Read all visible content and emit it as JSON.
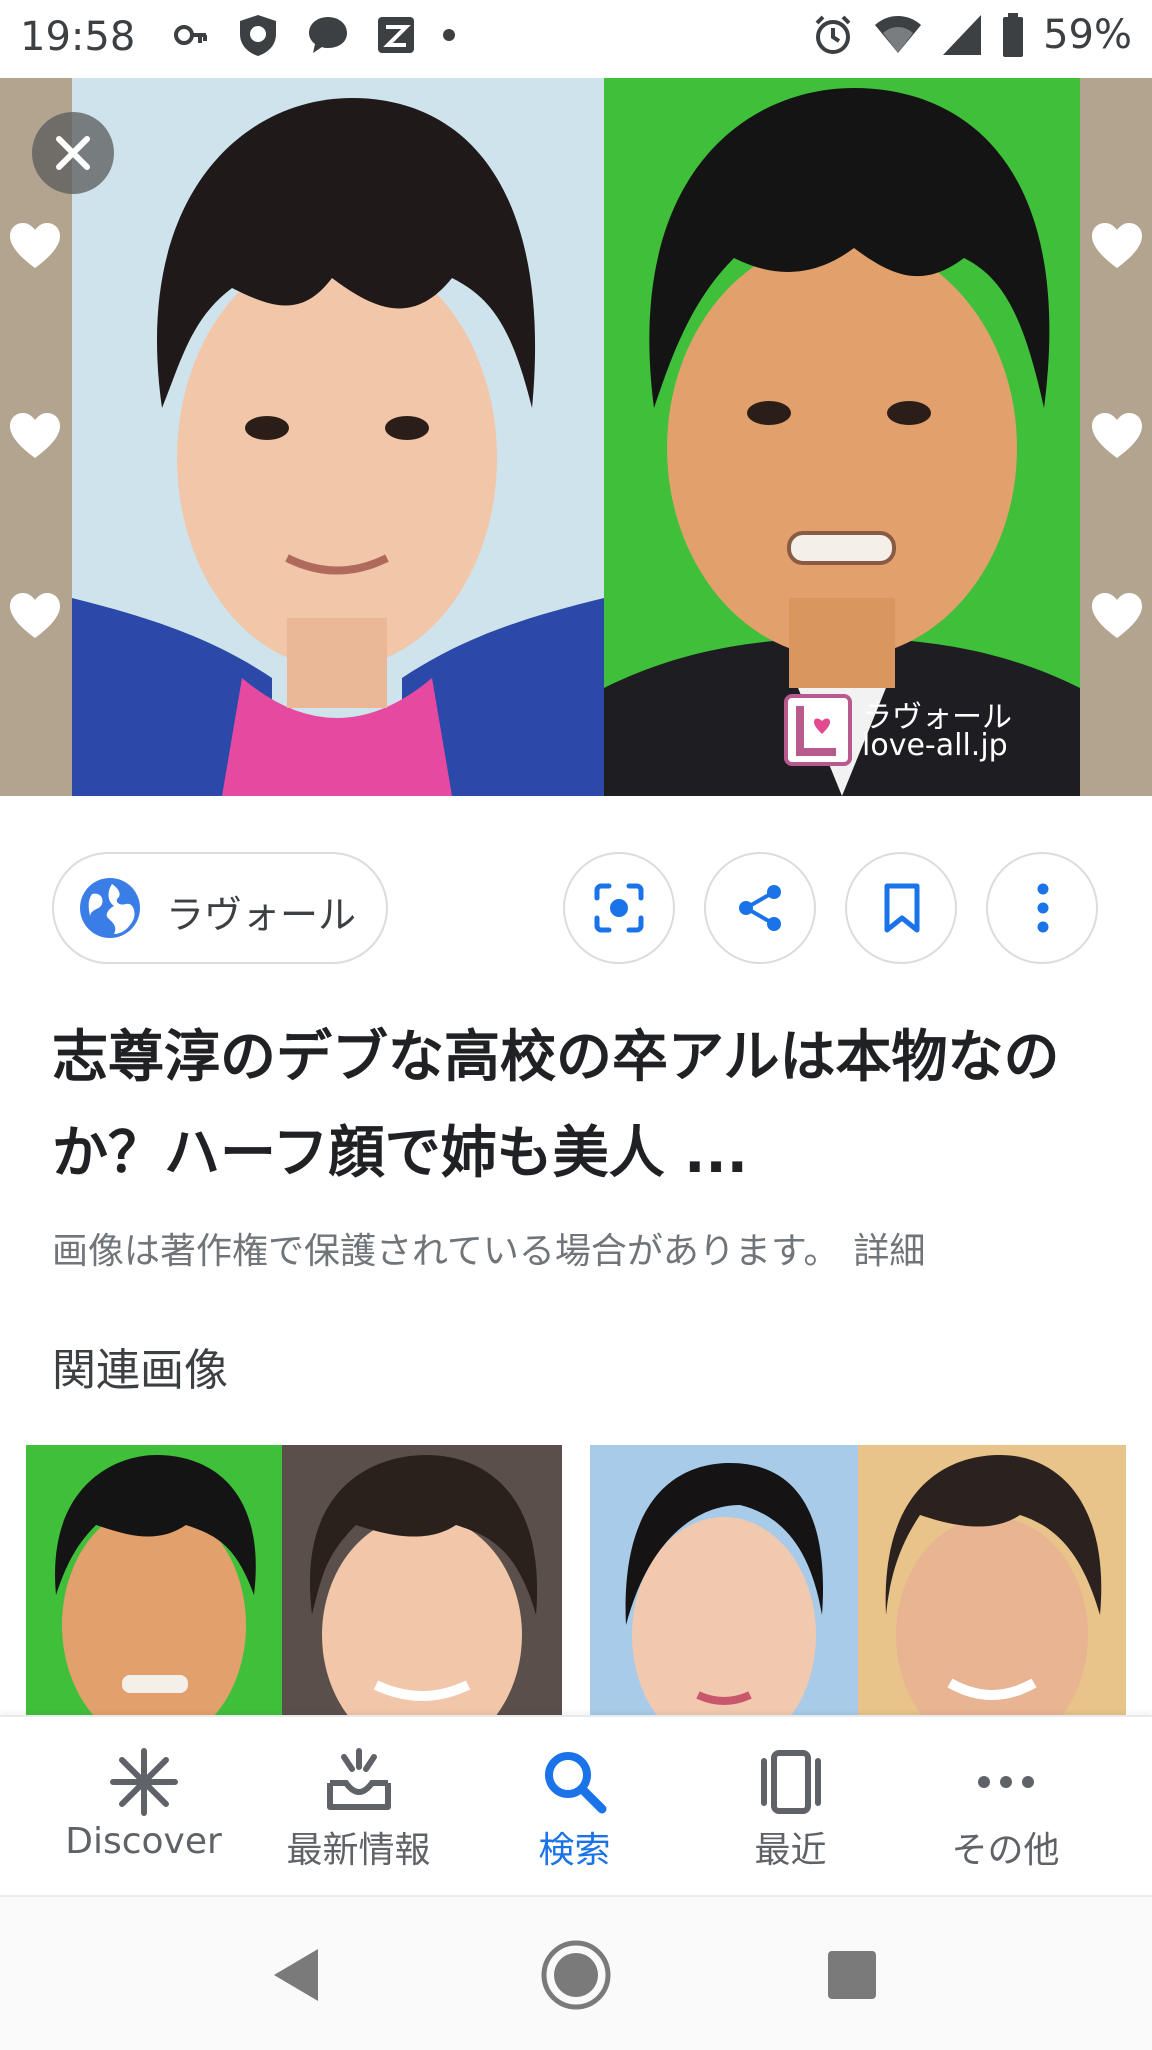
{
  "status_bar": {
    "time": "19:58",
    "battery": "59%",
    "icons": [
      "vpn-key-icon",
      "shield-icon",
      "chat-icon",
      "sms-icon",
      "dot-icon",
      "alarm-icon",
      "wifi-icon",
      "signal-icon",
      "battery-icon"
    ]
  },
  "hero": {
    "watermark_line1": "ラヴォール",
    "watermark_line2": "love-all.jp"
  },
  "actions": {
    "source_label": "ラヴォール",
    "buttons": [
      "lens-icon",
      "share-icon",
      "bookmark-icon",
      "more-vert-icon"
    ]
  },
  "result": {
    "title": "志尊淳のデブな高校の卒アルは本物なのか？ハーフ顔で姉も美人 ...",
    "copyright": "画像は著作権で保護されている場合があります。",
    "detail_link": "詳細"
  },
  "related": {
    "heading": "関連画像"
  },
  "bottom_nav": {
    "items": [
      {
        "label": "Discover",
        "icon": "discover-icon"
      },
      {
        "label": "最新情報",
        "icon": "updates-icon"
      },
      {
        "label": "検索",
        "icon": "search-icon"
      },
      {
        "label": "最近",
        "icon": "recent-icon"
      },
      {
        "label": "その他",
        "icon": "more-horiz-icon"
      }
    ],
    "active_index": 2
  },
  "colors": {
    "accent": "#1a73e8",
    "text_primary": "#202124",
    "text_secondary": "#70757a",
    "hero_side": "#b3a48f",
    "green_screen": "#3fbf3a"
  }
}
